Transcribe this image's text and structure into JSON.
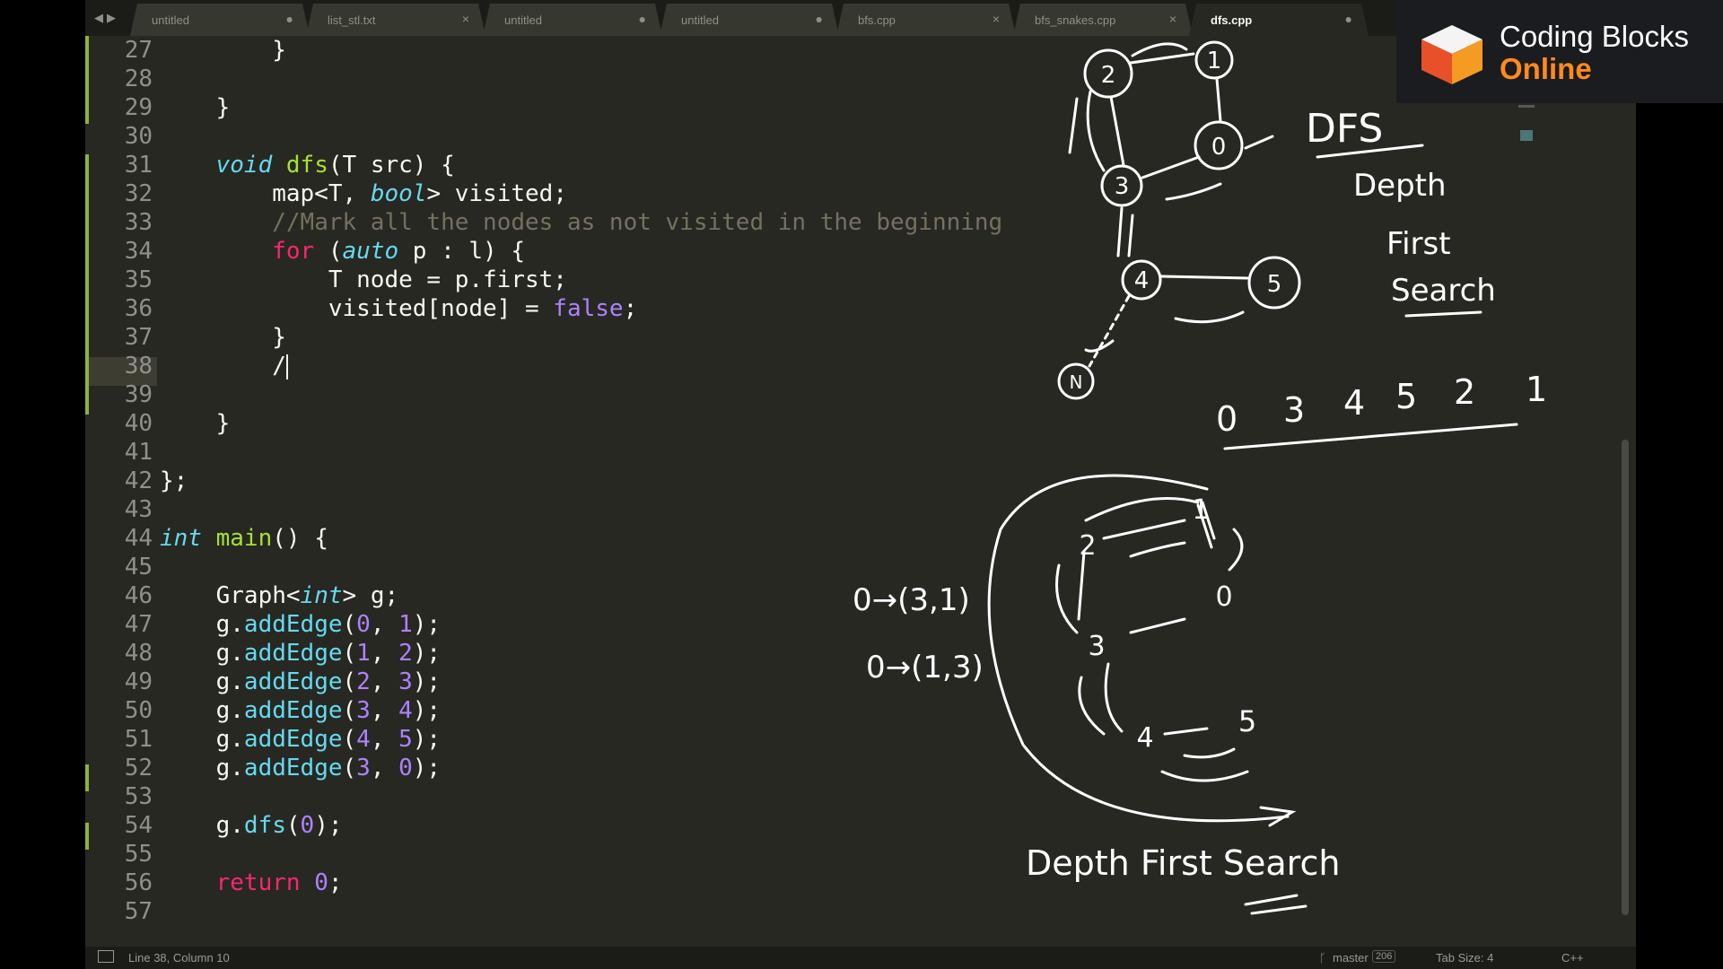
{
  "tabs": [
    {
      "label": "untitled",
      "modified": true
    },
    {
      "label": "list_stl.txt",
      "modified": false
    },
    {
      "label": "untitled",
      "modified": true
    },
    {
      "label": "untitled",
      "modified": true
    },
    {
      "label": "bfs.cpp",
      "modified": false
    },
    {
      "label": "bfs_snakes.cpp",
      "modified": false
    },
    {
      "label": "dfs.cpp",
      "modified": true,
      "active": true
    }
  ],
  "editor": {
    "lines": [
      {
        "n": "27",
        "code": "        }"
      },
      {
        "n": "28",
        "code": ""
      },
      {
        "n": "29",
        "code": "    }"
      },
      {
        "n": "30",
        "code": ""
      },
      {
        "n": "31",
        "code": "    void dfs(T src) {"
      },
      {
        "n": "32",
        "code": "        map<T, bool> visited;"
      },
      {
        "n": "33",
        "code": "        //Mark all the nodes as not visited in the beginning"
      },
      {
        "n": "34",
        "code": "        for (auto p : l) {"
      },
      {
        "n": "35",
        "code": "            T node = p.first;"
      },
      {
        "n": "36",
        "code": "            visited[node] = false;"
      },
      {
        "n": "37",
        "code": "        }"
      },
      {
        "n": "38",
        "code": "        /"
      },
      {
        "n": "39",
        "code": ""
      },
      {
        "n": "40",
        "code": "    }"
      },
      {
        "n": "41",
        "code": ""
      },
      {
        "n": "42",
        "code": "};"
      },
      {
        "n": "43",
        "code": ""
      },
      {
        "n": "44",
        "code": "int main() {"
      },
      {
        "n": "45",
        "code": ""
      },
      {
        "n": "46",
        "code": "    Graph<int> g;"
      },
      {
        "n": "47",
        "code": "    g.addEdge(0, 1);"
      },
      {
        "n": "48",
        "code": "    g.addEdge(1, 2);"
      },
      {
        "n": "49",
        "code": "    g.addEdge(2, 3);"
      },
      {
        "n": "50",
        "code": "    g.addEdge(3, 4);"
      },
      {
        "n": "51",
        "code": "    g.addEdge(4, 5);"
      },
      {
        "n": "52",
        "code": "    g.addEdge(3, 0);"
      },
      {
        "n": "53",
        "code": ""
      },
      {
        "n": "54",
        "code": "    g.dfs(0);"
      },
      {
        "n": "55",
        "code": ""
      },
      {
        "n": "56",
        "code": "    return 0;"
      },
      {
        "n": "57",
        "code": ""
      }
    ]
  },
  "status": {
    "position": "Line 38, Column 10",
    "branch": "master",
    "branch_count": "206",
    "tab_size": "Tab Size: 4",
    "syntax": "C++"
  },
  "brand": {
    "line1": "Coding Blocks",
    "line2": "Online"
  },
  "annotations": {
    "title": "DFS",
    "words": [
      "Depth",
      "First",
      "Search"
    ],
    "order": [
      "0",
      "3",
      "4",
      "5",
      "2",
      "1"
    ],
    "graph1_nodes": [
      "2",
      "1",
      "0",
      "3",
      "4",
      "5",
      "N"
    ],
    "graph2_nodes": [
      "2",
      "1",
      "0",
      "3",
      "4",
      "5"
    ],
    "adj1": "0→(3,1)",
    "adj2": "0→(1,3)",
    "caption": "Depth First Search"
  },
  "colors": {
    "editor_bg": "#272822",
    "keyword": "#f92672",
    "type": "#66d9ef",
    "function": "#a6e22e",
    "comment": "#75715e",
    "number": "#ae81ff",
    "brand_accent": "#ff8a1f",
    "git_modified": "#8cb33c"
  }
}
